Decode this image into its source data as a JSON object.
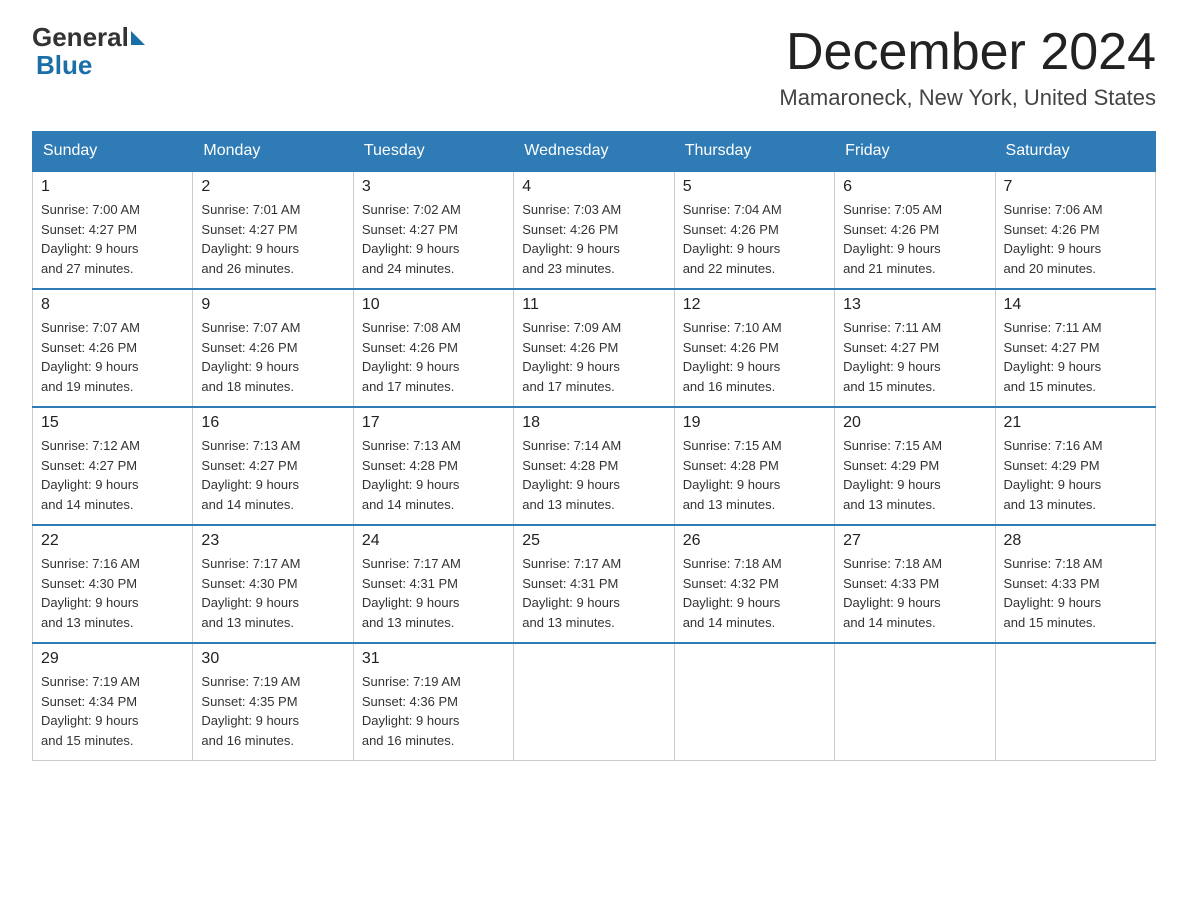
{
  "logo": {
    "general": "General",
    "blue": "Blue"
  },
  "header": {
    "month": "December 2024",
    "location": "Mamaroneck, New York, United States"
  },
  "days_of_week": [
    "Sunday",
    "Monday",
    "Tuesday",
    "Wednesday",
    "Thursday",
    "Friday",
    "Saturday"
  ],
  "weeks": [
    [
      {
        "day": "1",
        "sunrise": "7:00 AM",
        "sunset": "4:27 PM",
        "daylight": "9 hours and 27 minutes."
      },
      {
        "day": "2",
        "sunrise": "7:01 AM",
        "sunset": "4:27 PM",
        "daylight": "9 hours and 26 minutes."
      },
      {
        "day": "3",
        "sunrise": "7:02 AM",
        "sunset": "4:27 PM",
        "daylight": "9 hours and 24 minutes."
      },
      {
        "day": "4",
        "sunrise": "7:03 AM",
        "sunset": "4:26 PM",
        "daylight": "9 hours and 23 minutes."
      },
      {
        "day": "5",
        "sunrise": "7:04 AM",
        "sunset": "4:26 PM",
        "daylight": "9 hours and 22 minutes."
      },
      {
        "day": "6",
        "sunrise": "7:05 AM",
        "sunset": "4:26 PM",
        "daylight": "9 hours and 21 minutes."
      },
      {
        "day": "7",
        "sunrise": "7:06 AM",
        "sunset": "4:26 PM",
        "daylight": "9 hours and 20 minutes."
      }
    ],
    [
      {
        "day": "8",
        "sunrise": "7:07 AM",
        "sunset": "4:26 PM",
        "daylight": "9 hours and 19 minutes."
      },
      {
        "day": "9",
        "sunrise": "7:07 AM",
        "sunset": "4:26 PM",
        "daylight": "9 hours and 18 minutes."
      },
      {
        "day": "10",
        "sunrise": "7:08 AM",
        "sunset": "4:26 PM",
        "daylight": "9 hours and 17 minutes."
      },
      {
        "day": "11",
        "sunrise": "7:09 AM",
        "sunset": "4:26 PM",
        "daylight": "9 hours and 17 minutes."
      },
      {
        "day": "12",
        "sunrise": "7:10 AM",
        "sunset": "4:26 PM",
        "daylight": "9 hours and 16 minutes."
      },
      {
        "day": "13",
        "sunrise": "7:11 AM",
        "sunset": "4:27 PM",
        "daylight": "9 hours and 15 minutes."
      },
      {
        "day": "14",
        "sunrise": "7:11 AM",
        "sunset": "4:27 PM",
        "daylight": "9 hours and 15 minutes."
      }
    ],
    [
      {
        "day": "15",
        "sunrise": "7:12 AM",
        "sunset": "4:27 PM",
        "daylight": "9 hours and 14 minutes."
      },
      {
        "day": "16",
        "sunrise": "7:13 AM",
        "sunset": "4:27 PM",
        "daylight": "9 hours and 14 minutes."
      },
      {
        "day": "17",
        "sunrise": "7:13 AM",
        "sunset": "4:28 PM",
        "daylight": "9 hours and 14 minutes."
      },
      {
        "day": "18",
        "sunrise": "7:14 AM",
        "sunset": "4:28 PM",
        "daylight": "9 hours and 13 minutes."
      },
      {
        "day": "19",
        "sunrise": "7:15 AM",
        "sunset": "4:28 PM",
        "daylight": "9 hours and 13 minutes."
      },
      {
        "day": "20",
        "sunrise": "7:15 AM",
        "sunset": "4:29 PM",
        "daylight": "9 hours and 13 minutes."
      },
      {
        "day": "21",
        "sunrise": "7:16 AM",
        "sunset": "4:29 PM",
        "daylight": "9 hours and 13 minutes."
      }
    ],
    [
      {
        "day": "22",
        "sunrise": "7:16 AM",
        "sunset": "4:30 PM",
        "daylight": "9 hours and 13 minutes."
      },
      {
        "day": "23",
        "sunrise": "7:17 AM",
        "sunset": "4:30 PM",
        "daylight": "9 hours and 13 minutes."
      },
      {
        "day": "24",
        "sunrise": "7:17 AM",
        "sunset": "4:31 PM",
        "daylight": "9 hours and 13 minutes."
      },
      {
        "day": "25",
        "sunrise": "7:17 AM",
        "sunset": "4:31 PM",
        "daylight": "9 hours and 13 minutes."
      },
      {
        "day": "26",
        "sunrise": "7:18 AM",
        "sunset": "4:32 PM",
        "daylight": "9 hours and 14 minutes."
      },
      {
        "day": "27",
        "sunrise": "7:18 AM",
        "sunset": "4:33 PM",
        "daylight": "9 hours and 14 minutes."
      },
      {
        "day": "28",
        "sunrise": "7:18 AM",
        "sunset": "4:33 PM",
        "daylight": "9 hours and 15 minutes."
      }
    ],
    [
      {
        "day": "29",
        "sunrise": "7:19 AM",
        "sunset": "4:34 PM",
        "daylight": "9 hours and 15 minutes."
      },
      {
        "day": "30",
        "sunrise": "7:19 AM",
        "sunset": "4:35 PM",
        "daylight": "9 hours and 16 minutes."
      },
      {
        "day": "31",
        "sunrise": "7:19 AM",
        "sunset": "4:36 PM",
        "daylight": "9 hours and 16 minutes."
      },
      null,
      null,
      null,
      null
    ]
  ],
  "labels": {
    "sunrise_prefix": "Sunrise: ",
    "sunset_prefix": "Sunset: ",
    "daylight_prefix": "Daylight: "
  }
}
